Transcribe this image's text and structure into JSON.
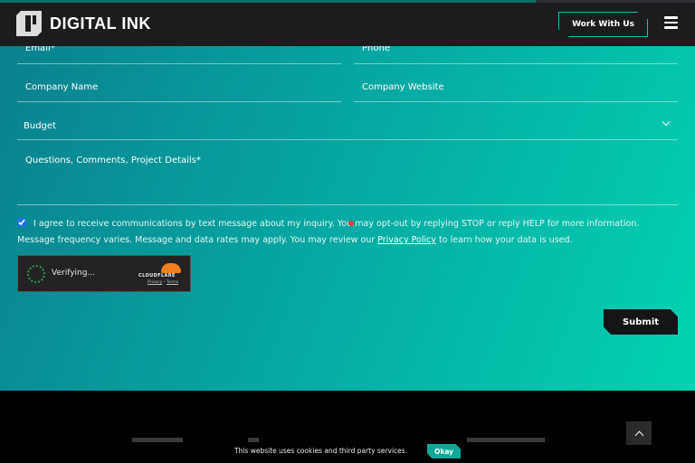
{
  "header": {
    "brand": "DIGITAL INK",
    "cta_label": "Work With Us",
    "menu_icon": "hamburger-menu-icon"
  },
  "form": {
    "fields": {
      "email_placeholder": "Email*",
      "phone_placeholder": "Phone",
      "company_name_placeholder": "Company Name",
      "company_website_placeholder": "Company Website",
      "budget_label": "Budget",
      "questions_placeholder": "Questions, Comments, Project Details*"
    },
    "consent": {
      "checked": true,
      "text_before_link": "I agree to receive communications by text message about my inquiry. You may opt-out by replying STOP or reply HELP for more information. Message frequency varies. Message and data rates may apply. You may review our",
      "link_text": "Privacy Policy",
      "text_after_link": "to learn how your data is used."
    },
    "captcha": {
      "status": "Verifying...",
      "provider": "CLOUDFLARE",
      "privacy_link": "Privacy",
      "separator": "·",
      "terms_link": "Terms"
    },
    "submit_label": "Submit"
  },
  "cookie_bar": {
    "message": "This website uses cookies and third party services.",
    "okay_label": "Okay"
  },
  "colors": {
    "gradient_start": "#0b7f8d",
    "gradient_end": "#02d2b1",
    "accent": "#14c0ac",
    "dark": "#1b1c1e"
  }
}
